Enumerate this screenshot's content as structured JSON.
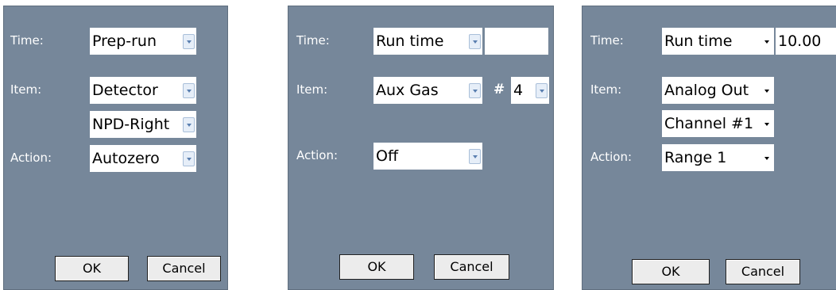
{
  "dialogs": [
    {
      "time_label": "Time:",
      "time_select": "Prep-run",
      "item_label": "Item:",
      "item_select": "Detector",
      "item_sub_select": "NPD-Right",
      "action_label": "Action:",
      "action_select": "Autozero",
      "ok_label": "OK",
      "cancel_label": "Cancel"
    },
    {
      "time_label": "Time:",
      "time_select": "Run time",
      "time_value": "",
      "item_label": "Item:",
      "item_select": "Aux Gas",
      "number_label": "#",
      "number_select": "4",
      "action_label": "Action:",
      "action_select": "Off",
      "ok_label": "OK",
      "cancel_label": "Cancel"
    },
    {
      "time_label": "Time:",
      "time_select": "Run time",
      "time_value": "10.00",
      "item_label": "Item:",
      "item_select": "Analog Out",
      "item_sub_select": "Channel #1",
      "action_label": "Action:",
      "action_select": "Range 1",
      "ok_label": "OK",
      "cancel_label": "Cancel"
    }
  ],
  "colors": {
    "panel_background": "#76879a",
    "field_background": "#ffffff",
    "label_text": "#ffffff"
  },
  "icons": {
    "dropdown_arrow": "chevron-down-icon"
  }
}
